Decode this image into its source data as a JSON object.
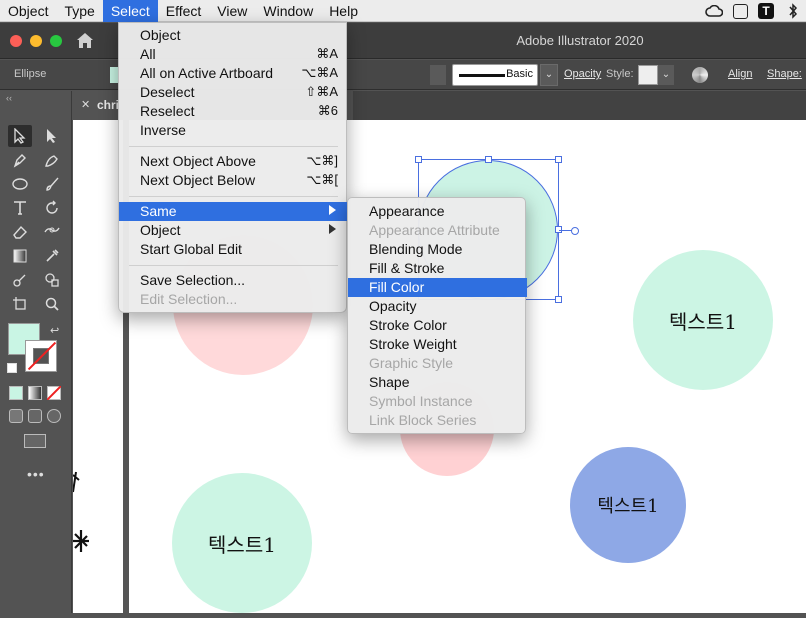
{
  "menubar": {
    "items": [
      "Object",
      "Type",
      "Select",
      "Effect",
      "View",
      "Window",
      "Help"
    ],
    "active": "Select",
    "tray_icons": [
      "creative-cloud-icon",
      "checkbox-icon",
      "t-icon",
      "bluetooth-icon"
    ]
  },
  "titlebar": {
    "title": "Adobe Illustrator 2020"
  },
  "controlbar": {
    "object_kind": "Ellipse",
    "stroke_style": "Basic",
    "opacity_label": "Opacity",
    "style_label": "Style:",
    "align_label": "Align",
    "shape_label": "Shape:"
  },
  "document": {
    "tab_name": "chri"
  },
  "select_menu": {
    "items": [
      {
        "label": "Object",
        "shortcut": "",
        "state": "normal"
      },
      {
        "label": "All",
        "shortcut": "⌘A",
        "state": "normal"
      },
      {
        "label": "All on Active Artboard",
        "shortcut": "⌥⌘A",
        "state": "normal"
      },
      {
        "label": "Deselect",
        "shortcut": "⇧⌘A",
        "state": "normal"
      },
      {
        "label": "Reselect",
        "shortcut": "⌘6",
        "state": "normal"
      },
      {
        "label": "Inverse",
        "shortcut": "",
        "state": "normal"
      },
      {
        "label": "Next Object Above",
        "shortcut": "⌥⌘]",
        "state": "normal"
      },
      {
        "label": "Next Object Below",
        "shortcut": "⌥⌘[",
        "state": "normal"
      },
      {
        "label": "Same",
        "shortcut": "",
        "state": "highlighted",
        "submenu": true
      },
      {
        "label": "Object",
        "shortcut": "",
        "state": "normal",
        "submenu": true
      },
      {
        "label": "Start Global Edit",
        "shortcut": "",
        "state": "normal"
      },
      {
        "label": "Save Selection...",
        "shortcut": "",
        "state": "normal"
      },
      {
        "label": "Edit Selection...",
        "shortcut": "",
        "state": "disabled"
      }
    ]
  },
  "same_submenu": {
    "items": [
      {
        "label": "Appearance",
        "state": "normal"
      },
      {
        "label": "Appearance Attribute",
        "state": "disabled"
      },
      {
        "label": "Blending Mode",
        "state": "normal"
      },
      {
        "label": "Fill & Stroke",
        "state": "normal"
      },
      {
        "label": "Fill Color",
        "state": "highlighted"
      },
      {
        "label": "Opacity",
        "state": "normal"
      },
      {
        "label": "Stroke Color",
        "state": "normal"
      },
      {
        "label": "Stroke Weight",
        "state": "normal"
      },
      {
        "label": "Graphic Style",
        "state": "disabled"
      },
      {
        "label": "Shape",
        "state": "normal"
      },
      {
        "label": "Symbol Instance",
        "state": "disabled"
      },
      {
        "label": "Link Block Series",
        "state": "disabled"
      }
    ]
  },
  "canvas": {
    "circle_text_right": "텍스트1",
    "circle_text_blue": "텍스트1",
    "circle_text_bottom": "텍스트1"
  },
  "colors": {
    "accent": "#2f6fe0",
    "mint": "#ccf5e4",
    "pink": "#ffd9da",
    "blue_circle": "#8ea8e6",
    "fill_swatch": "#c9f5e4"
  }
}
